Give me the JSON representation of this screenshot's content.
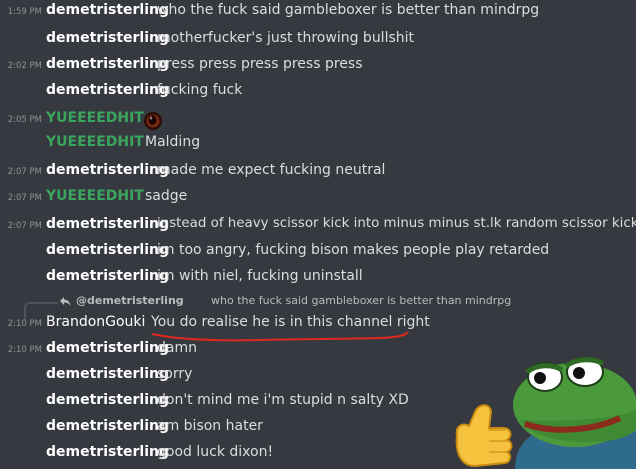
{
  "messages": [
    {
      "time": "1:59 PM",
      "author": "demetristerling",
      "text": "who the fuck said gambleboxer is better than mindrpg"
    },
    {
      "time": "",
      "author": "demetristerling",
      "text": "motherfucker's just throwing bullshit"
    },
    {
      "time": "2:02 PM",
      "author": "demetristerling",
      "text": "press press press press press"
    },
    {
      "time": "",
      "author": "demetristerling",
      "text": "fucking fuck"
    },
    {
      "time": "2:05 PM",
      "author": "YUEEEEDHIT",
      "text": ""
    },
    {
      "time": "",
      "author": "YUEEEEDHIT",
      "text": "Malding"
    },
    {
      "time": "2:07 PM",
      "author": "demetristerling",
      "text": "made me expect fucking neutral"
    },
    {
      "time": "2:07 PM",
      "author": "YUEEEEDHIT",
      "text": "sadge"
    },
    {
      "time": "2:07 PM",
      "author": "demetristerling",
      "text": "instead of heavy scissor kick into minus minus st.lk random scissor kick"
    },
    {
      "time": "",
      "author": "demetristerling",
      "text": "im too angry, fucking bison makes people play retarded"
    },
    {
      "time": "",
      "author": "demetristerling",
      "text": "im with niel, fucking uninstall"
    },
    {
      "time": "2:10 PM",
      "author": "BrandonGouki",
      "text": "You do realise he is in this channel right"
    },
    {
      "time": "2:10 PM",
      "author": "demetristerling",
      "text": "damn"
    },
    {
      "time": "",
      "author": "demetristerling",
      "text": "sorry"
    },
    {
      "time": "",
      "author": "demetristerling",
      "text": "don't mind me i'm stupid n salty XD"
    },
    {
      "time": "",
      "author": "demetristerling",
      "text": "am bison hater"
    },
    {
      "time": "",
      "author": "demetristerling",
      "text": "good luck dixon!"
    }
  ],
  "reply": {
    "name": "@demetristerling",
    "text": "who the fuck said gambleboxer is better than mindrpg"
  },
  "colors": {
    "background": "#36393f",
    "username_white": "#ffffff",
    "username_green": "#3ba55d",
    "message_text": "#dcddde",
    "timestamp": "#8e9297",
    "underline_red": "#e0281e"
  },
  "icons": {
    "reply": "reply-arrow-icon",
    "emoji": "custom-emoji-icon",
    "sticker": "pepe-thumbs-up-sticker"
  }
}
